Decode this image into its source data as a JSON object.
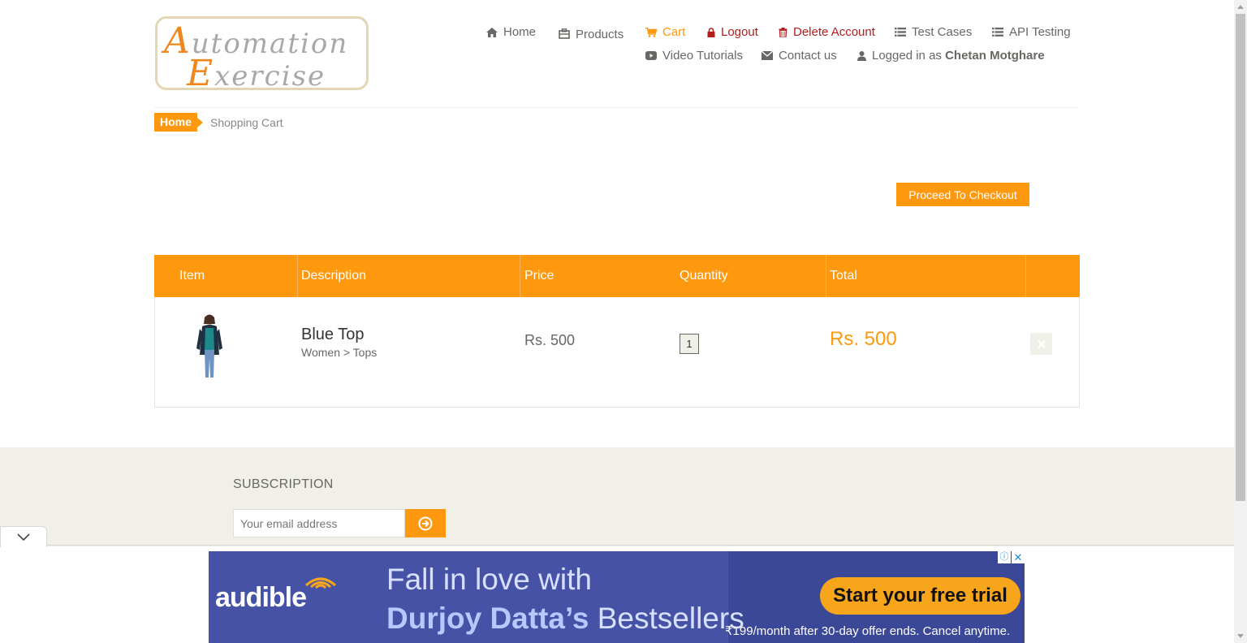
{
  "logo": {
    "line1_cap": "A",
    "line1_rest": "utomation",
    "line2_cap": "E",
    "line2_rest": "xercise"
  },
  "nav": {
    "home": "Home",
    "products": "Products",
    "cart": "Cart",
    "logout": "Logout",
    "delete_account": "Delete Account",
    "test_cases": "Test Cases",
    "api_testing": "API Testing",
    "video_tutorials": "Video Tutorials",
    "contact_us": "Contact us",
    "logged_in_prefix": "Logged in as",
    "logged_in_user": "Chetan Motghare"
  },
  "breadcrumb": {
    "home": "Home",
    "current": "Shopping Cart"
  },
  "checkout_button": "Proceed To Checkout",
  "cart_table": {
    "headers": [
      "Item",
      "Description",
      "Price",
      "Quantity",
      "Total"
    ],
    "rows": [
      {
        "name": "Blue Top",
        "category": "Women > Tops",
        "price": "Rs. 500",
        "quantity": "1",
        "total": "Rs. 500"
      }
    ]
  },
  "footer": {
    "subscription_title": "SUBSCRIPTION",
    "email_placeholder": "Your email address"
  },
  "ad": {
    "brand": "audible",
    "headline1": "Fall in love with",
    "headline2_bold": "Durjoy Datta’s",
    "headline2_rest": " Bestsellers",
    "cta": "Start your free trial",
    "fine_print": "₹199/month after 30-day offer ends. Cancel anytime.",
    "info_glyph": "ⓘ",
    "close_glyph": "✕"
  },
  "colors": {
    "accent": "#fe980f",
    "danger": "#b41c1c",
    "footer_bg": "#f0f0e9",
    "ad_bg": "#4552a6"
  },
  "icons": [
    "home-icon",
    "products-icon",
    "cart-icon",
    "lock-icon",
    "trash-icon",
    "list-icon",
    "video-icon",
    "envelope-icon",
    "user-icon",
    "arrow-circle-right-icon",
    "close-icon",
    "chevron-down-icon"
  ]
}
